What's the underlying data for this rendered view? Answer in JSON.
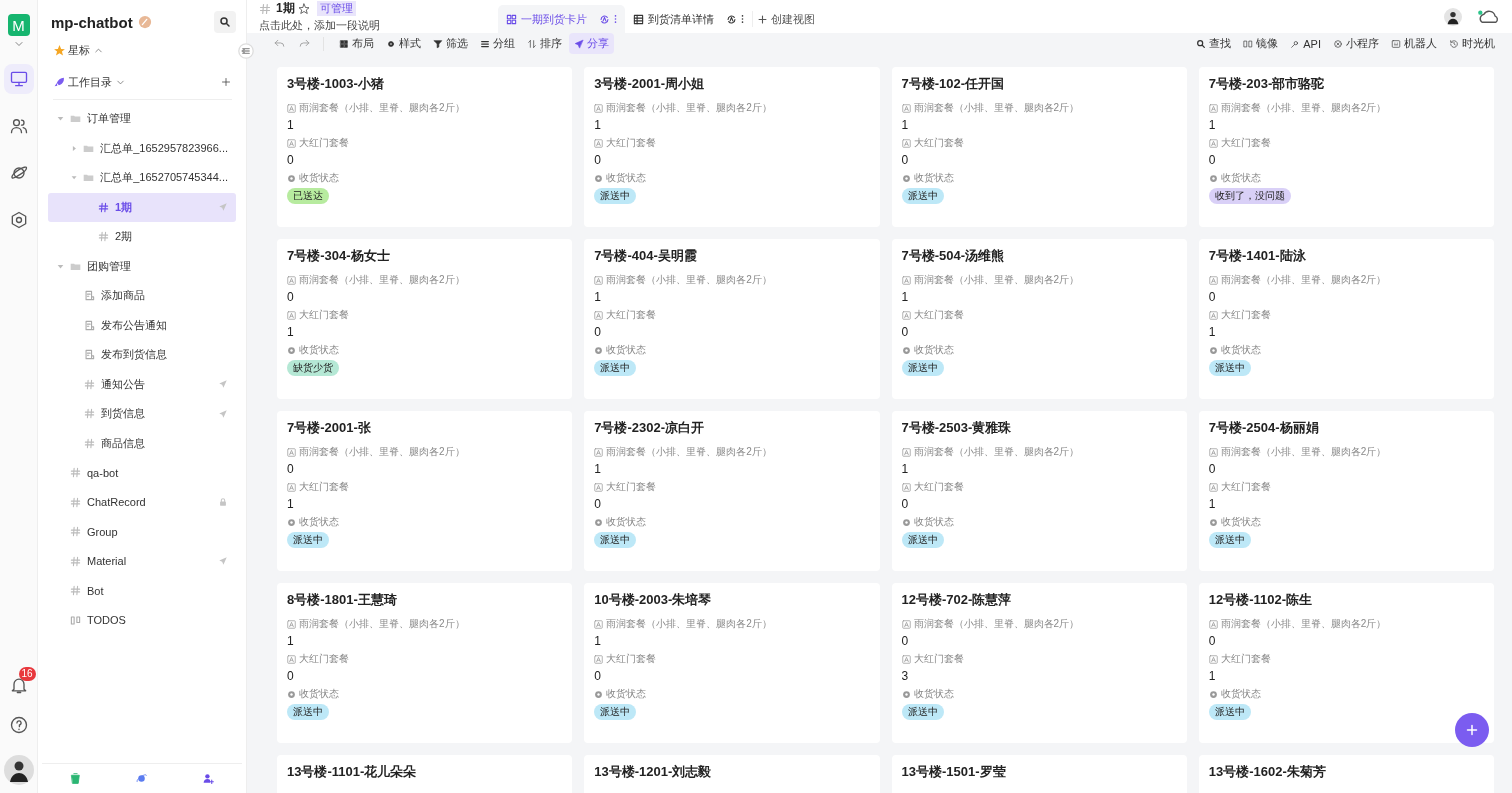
{
  "rail": {
    "workspace_initial": "M",
    "nav": [
      {
        "selected": true
      },
      {
        "selected": false
      },
      {
        "selected": false
      },
      {
        "selected": false
      }
    ],
    "notifications": "16"
  },
  "sidebar": {
    "title": "mp-chatbot",
    "sections": [
      {
        "label": "星标",
        "expanded": true
      },
      {
        "label": "工作目录",
        "expanded": false
      }
    ],
    "tree": [
      {
        "label": "订单管理",
        "kind": "folder",
        "expanded": true,
        "selected": false,
        "shared": false,
        "locked": false,
        "children": [
          {
            "label": "汇总单_1652957823966...",
            "kind": "folder",
            "expanded": false,
            "selected": false,
            "shared": false,
            "locked": false
          },
          {
            "label": "汇总单_1652705745344...",
            "kind": "folder",
            "expanded": true,
            "selected": false,
            "shared": false,
            "locked": false,
            "children": [
              {
                "label": "1期",
                "kind": "table",
                "selected": true,
                "shared": true,
                "locked": false
              },
              {
                "label": "2期",
                "kind": "table",
                "selected": false,
                "shared": false,
                "locked": false
              }
            ]
          }
        ]
      },
      {
        "label": "团购管理",
        "kind": "folder",
        "expanded": true,
        "selected": false,
        "shared": false,
        "locked": false,
        "children": [
          {
            "label": "添加商品",
            "kind": "form",
            "selected": false,
            "shared": false,
            "locked": false
          },
          {
            "label": "发布公告通知",
            "kind": "form",
            "selected": false,
            "shared": false,
            "locked": false
          },
          {
            "label": "发布到货信息",
            "kind": "form",
            "selected": false,
            "shared": false,
            "locked": false
          },
          {
            "label": "通知公告",
            "kind": "table",
            "selected": false,
            "shared": true,
            "locked": false
          },
          {
            "label": "到货信息",
            "kind": "table",
            "selected": false,
            "shared": true,
            "locked": false
          },
          {
            "label": "商品信息",
            "kind": "table",
            "selected": false,
            "shared": false,
            "locked": false
          }
        ]
      },
      {
        "label": "qa-bot",
        "kind": "table",
        "selected": false,
        "shared": false,
        "locked": false
      },
      {
        "label": "ChatRecord",
        "kind": "table",
        "selected": false,
        "shared": false,
        "locked": true
      },
      {
        "label": "Group",
        "kind": "table",
        "selected": false,
        "shared": false,
        "locked": false
      },
      {
        "label": "Material",
        "kind": "table",
        "selected": false,
        "shared": true,
        "locked": false
      },
      {
        "label": "Bot",
        "kind": "table",
        "selected": false,
        "shared": false,
        "locked": false
      },
      {
        "label": "TODOS",
        "kind": "kanban",
        "selected": false,
        "shared": false,
        "locked": false
      }
    ]
  },
  "header": {
    "title": "1期",
    "permission": "可管理",
    "description": "点击此处，添加一段说明",
    "views": [
      {
        "label": "一期到货卡片",
        "kind": "gallery",
        "selected": true
      },
      {
        "label": "到货清单详情",
        "kind": "grid",
        "selected": false
      }
    ],
    "create_view": "创建视图"
  },
  "toolbar": {
    "left": [
      {
        "label": "布局",
        "selected": false
      },
      {
        "label": "样式",
        "selected": false
      },
      {
        "label": "筛选",
        "selected": false
      },
      {
        "label": "分组",
        "selected": false
      },
      {
        "label": "排序",
        "selected": false
      },
      {
        "label": "分享",
        "selected": true
      }
    ],
    "right": [
      "查找",
      "镜像",
      "API",
      "小程序",
      "机器人",
      "时光机"
    ]
  },
  "cards": [
    {
      "title": "3号楼-1003-小猪",
      "fields": [
        {
          "label": "雨润套餐（小排、里脊、腿肉各2斤）",
          "value": "1"
        },
        {
          "label": "大红门套餐",
          "value": "0"
        }
      ],
      "status": {
        "label": "收货状态",
        "value": "已送达",
        "color": "#b7eb9f"
      }
    },
    {
      "title": "3号楼-2001-周小姐",
      "fields": [
        {
          "label": "雨润套餐（小排、里脊、腿肉各2斤）",
          "value": "1"
        },
        {
          "label": "大红门套餐",
          "value": "0"
        }
      ],
      "status": {
        "label": "收货状态",
        "value": "派送中",
        "color": "#bde8f7"
      }
    },
    {
      "title": "7号楼-102-任开国",
      "fields": [
        {
          "label": "雨润套餐（小排、里脊、腿肉各2斤）",
          "value": "1"
        },
        {
          "label": "大红门套餐",
          "value": "0"
        }
      ],
      "status": {
        "label": "收货状态",
        "value": "派送中",
        "color": "#bde8f7"
      }
    },
    {
      "title": "7号楼-203-部市骆驼",
      "fields": [
        {
          "label": "雨润套餐（小排、里脊、腿肉各2斤）",
          "value": "1"
        },
        {
          "label": "大红门套餐",
          "value": "0"
        }
      ],
      "status": {
        "label": "收货状态",
        "value": "收到了，没问题",
        "color": "#d9d0f7"
      }
    },
    {
      "title": "7号楼-304-杨女士",
      "fields": [
        {
          "label": "雨润套餐（小排、里脊、腿肉各2斤）",
          "value": "0"
        },
        {
          "label": "大红门套餐",
          "value": "1"
        }
      ],
      "status": {
        "label": "收货状态",
        "value": "缺货少货",
        "color": "#b5e8d5"
      }
    },
    {
      "title": "7号楼-404-吴明霞",
      "fields": [
        {
          "label": "雨润套餐（小排、里脊、腿肉各2斤）",
          "value": "1"
        },
        {
          "label": "大红门套餐",
          "value": "0"
        }
      ],
      "status": {
        "label": "收货状态",
        "value": "派送中",
        "color": "#bde8f7"
      }
    },
    {
      "title": "7号楼-504-汤维熊",
      "fields": [
        {
          "label": "雨润套餐（小排、里脊、腿肉各2斤）",
          "value": "1"
        },
        {
          "label": "大红门套餐",
          "value": "0"
        }
      ],
      "status": {
        "label": "收货状态",
        "value": "派送中",
        "color": "#bde8f7"
      }
    },
    {
      "title": "7号楼-1401-陆泳",
      "fields": [
        {
          "label": "雨润套餐（小排、里脊、腿肉各2斤）",
          "value": "0"
        },
        {
          "label": "大红门套餐",
          "value": "1"
        }
      ],
      "status": {
        "label": "收货状态",
        "value": "派送中",
        "color": "#bde8f7"
      }
    },
    {
      "title": "7号楼-2001-张",
      "fields": [
        {
          "label": "雨润套餐（小排、里脊、腿肉各2斤）",
          "value": "0"
        },
        {
          "label": "大红门套餐",
          "value": "1"
        }
      ],
      "status": {
        "label": "收货状态",
        "value": "派送中",
        "color": "#bde8f7"
      }
    },
    {
      "title": "7号楼-2302-凉白开",
      "fields": [
        {
          "label": "雨润套餐（小排、里脊、腿肉各2斤）",
          "value": "1"
        },
        {
          "label": "大红门套餐",
          "value": "0"
        }
      ],
      "status": {
        "label": "收货状态",
        "value": "派送中",
        "color": "#bde8f7"
      }
    },
    {
      "title": "7号楼-2503-黄雅珠",
      "fields": [
        {
          "label": "雨润套餐（小排、里脊、腿肉各2斤）",
          "value": "1"
        },
        {
          "label": "大红门套餐",
          "value": "0"
        }
      ],
      "status": {
        "label": "收货状态",
        "value": "派送中",
        "color": "#bde8f7"
      }
    },
    {
      "title": "7号楼-2504-杨丽娟",
      "fields": [
        {
          "label": "雨润套餐（小排、里脊、腿肉各2斤）",
          "value": "0"
        },
        {
          "label": "大红门套餐",
          "value": "1"
        }
      ],
      "status": {
        "label": "收货状态",
        "value": "派送中",
        "color": "#bde8f7"
      }
    },
    {
      "title": "8号楼-1801-王慧琦",
      "fields": [
        {
          "label": "雨润套餐（小排、里脊、腿肉各2斤）",
          "value": "1"
        },
        {
          "label": "大红门套餐",
          "value": "0"
        }
      ],
      "status": {
        "label": "收货状态",
        "value": "派送中",
        "color": "#bde8f7"
      }
    },
    {
      "title": "10号楼-2003-朱培琴",
      "fields": [
        {
          "label": "雨润套餐（小排、里脊、腿肉各2斤）",
          "value": "1"
        },
        {
          "label": "大红门套餐",
          "value": "0"
        }
      ],
      "status": {
        "label": "收货状态",
        "value": "派送中",
        "color": "#bde8f7"
      }
    },
    {
      "title": "12号楼-702-陈慧萍",
      "fields": [
        {
          "label": "雨润套餐（小排、里脊、腿肉各2斤）",
          "value": "0"
        },
        {
          "label": "大红门套餐",
          "value": "3"
        }
      ],
      "status": {
        "label": "收货状态",
        "value": "派送中",
        "color": "#bde8f7"
      }
    },
    {
      "title": "12号楼-1102-陈生",
      "fields": [
        {
          "label": "雨润套餐（小排、里脊、腿肉各2斤）",
          "value": "0"
        },
        {
          "label": "大红门套餐",
          "value": "1"
        }
      ],
      "status": {
        "label": "收货状态",
        "value": "派送中",
        "color": "#bde8f7"
      }
    },
    {
      "title": "13号楼-1101-花儿朵朵"
    },
    {
      "title": "13号楼-1201-刘志毅"
    },
    {
      "title": "13号楼-1501-罗莹"
    },
    {
      "title": "13号楼-1602-朱菊芳"
    }
  ]
}
